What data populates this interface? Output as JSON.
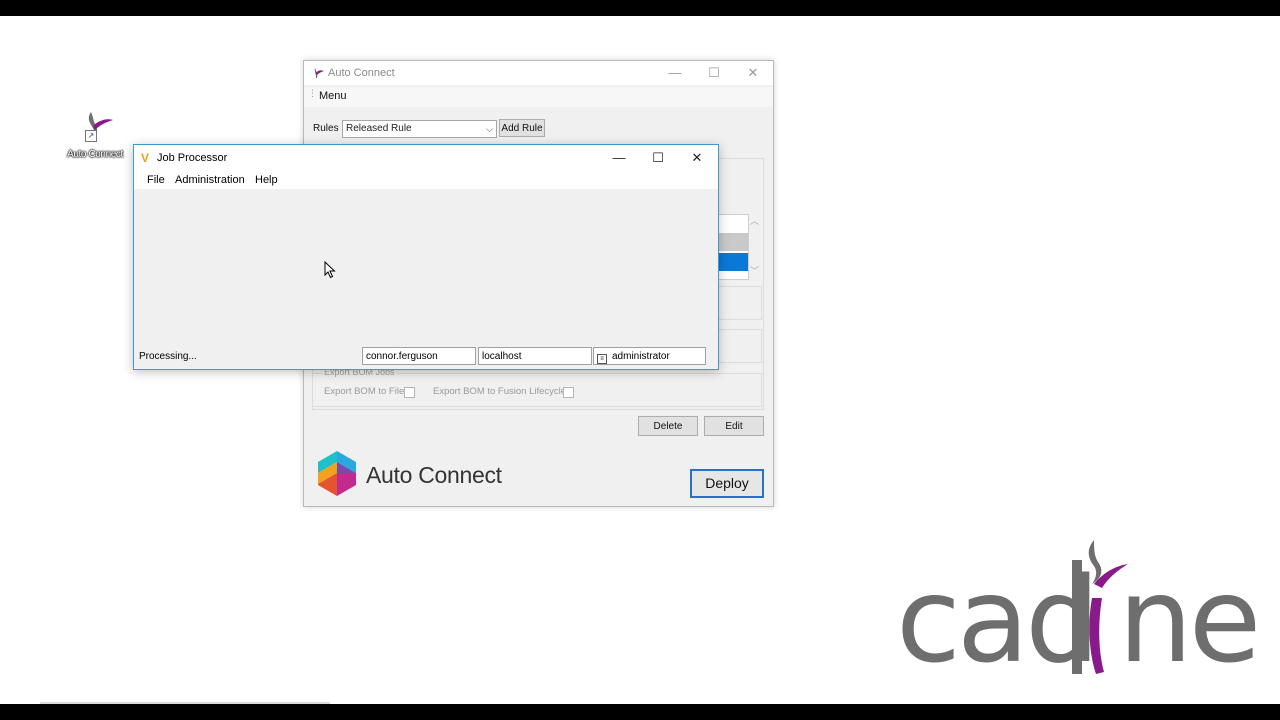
{
  "desktop": {
    "shortcut_label": "Auto Connect"
  },
  "auto_connect": {
    "title": "Auto Connect",
    "menu_label": "Menu",
    "rules_label": "Rules",
    "rules_selected": "Released Rule",
    "add_rule_label": "Add Rule",
    "export_group_title": "Export BOM Jobs",
    "export_bom_file_label": "Export BOM to File",
    "export_bom_fusion_label": "Export BOM to Fusion Lifecycle",
    "delete_label": "Delete",
    "edit_label": "Edit",
    "brand_name": "Auto Connect",
    "deploy_label": "Deploy"
  },
  "job_processor": {
    "title": "Job Processor",
    "menu": [
      "File",
      "Administration",
      "Help"
    ],
    "status": "Processing...",
    "user": "connor.ferguson",
    "server": "localhost",
    "account": "administrator"
  },
  "watermark": {
    "text_left": "cad",
    "text_right": "ne"
  },
  "colors": {
    "accent_blue": "#0a78d7",
    "cadline_gray": "#6e6e6e",
    "cadline_purple": "#8a1a8c"
  }
}
